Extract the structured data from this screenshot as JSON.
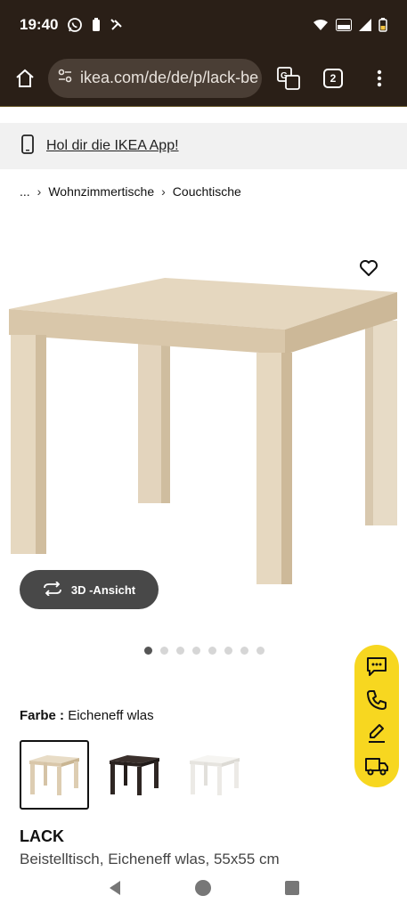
{
  "status_bar": {
    "time": "19:40"
  },
  "browser": {
    "url": "ikea.com/de/de/p/lack-be",
    "tab_count": "2"
  },
  "app_banner": {
    "text": "Hol dir die IKEA App!"
  },
  "breadcrumb": {
    "items": [
      "...",
      "Wohnzimmertische",
      "Couchtische"
    ],
    "separator": "›"
  },
  "gallery": {
    "view_3d_label": "3D -Ansicht",
    "total_images": 8,
    "active_index": 0
  },
  "colors": {
    "label": "Farbe :",
    "selected_value": "Eicheneff wlas",
    "options": [
      {
        "name": "oak-effect-white-stained",
        "hex": "#e3d4bd"
      },
      {
        "name": "black-brown",
        "hex": "#2e2623"
      },
      {
        "name": "white",
        "hex": "#f4f2ee"
      }
    ]
  },
  "product": {
    "name": "LACK",
    "description": "Beistelltisch, Eicheneff wlas, 55x55 cm"
  },
  "fab_icons": [
    "chat-icon",
    "phone-icon",
    "edit-icon",
    "truck-icon"
  ],
  "theme": {
    "brand_yellow": "#f7d720",
    "toolbar_bg": "#2a1f17",
    "wood": "#e3d4bd"
  }
}
